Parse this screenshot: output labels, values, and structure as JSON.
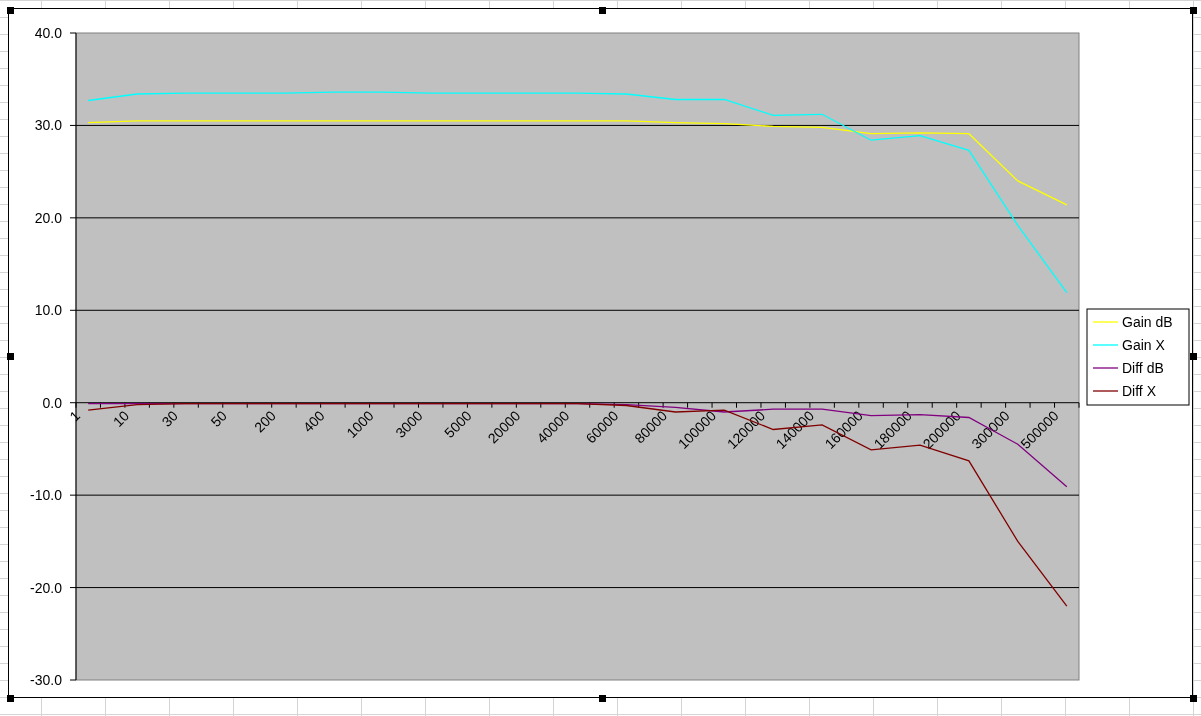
{
  "chart_data": {
    "type": "line",
    "grid": true,
    "legend": true,
    "categories": [
      "1",
      "10",
      "30",
      "50",
      "200",
      "400",
      "1000",
      "3000",
      "5000",
      "20000",
      "40000",
      "60000",
      "80000",
      "100000",
      "120000",
      "140000",
      "160000",
      "180000",
      "200000",
      "300000",
      "500000"
    ],
    "ylim": [
      -30,
      40
    ],
    "yticks": [
      {
        "value": 40,
        "label": "40.0"
      },
      {
        "value": 30,
        "label": "30.0"
      },
      {
        "value": 20,
        "label": "20.0"
      },
      {
        "value": 10,
        "label": "10.0"
      },
      {
        "value": 0,
        "label": "0.0"
      },
      {
        "value": -10,
        "label": "-10.0"
      },
      {
        "value": -20,
        "label": "-20.0"
      },
      {
        "value": -30,
        "label": "-30.0"
      }
    ],
    "series": [
      {
        "name": "Gain dB",
        "color": "#ffff00",
        "values": [
          30.3,
          30.5,
          30.5,
          30.5,
          30.5,
          30.5,
          30.5,
          30.5,
          30.5,
          30.5,
          30.5,
          30.5,
          30.3,
          30.2,
          29.9,
          29.8,
          29.1,
          29.2,
          29.1,
          24.0,
          21.4
        ]
      },
      {
        "name": "Gain X",
        "color": "#00ffff",
        "values": [
          32.7,
          33.4,
          33.5,
          33.5,
          33.5,
          33.6,
          33.6,
          33.5,
          33.5,
          33.5,
          33.5,
          33.4,
          32.8,
          32.8,
          31.1,
          31.2,
          28.4,
          28.9,
          27.3,
          19.2,
          11.9
        ]
      },
      {
        "name": "Diff dB",
        "color": "#800080",
        "values": [
          -0.1,
          -0.1,
          -0.1,
          -0.1,
          -0.1,
          -0.1,
          -0.1,
          -0.1,
          -0.1,
          -0.1,
          -0.1,
          -0.2,
          -0.5,
          -1.0,
          -0.7,
          -0.7,
          -1.4,
          -1.3,
          -1.6,
          -4.5,
          -9.1
        ]
      },
      {
        "name": "Diff X",
        "color": "#800000",
        "values": [
          -0.8,
          -0.2,
          -0.1,
          -0.1,
          -0.1,
          -0.1,
          -0.1,
          -0.1,
          -0.1,
          -0.1,
          -0.1,
          -0.3,
          -1.0,
          -0.8,
          -2.9,
          -2.4,
          -5.1,
          -4.6,
          -6.3,
          -15.0,
          -22.0
        ]
      }
    ]
  }
}
